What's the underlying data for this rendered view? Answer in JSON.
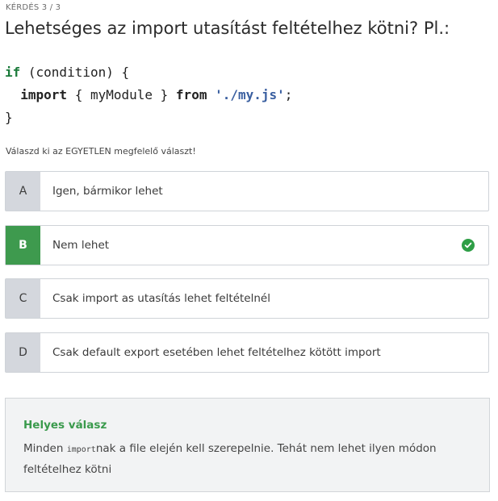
{
  "question": {
    "counter": "KÉRDÉS 3 / 3",
    "title": "Lehetséges az import utasítást feltételhez kötni? Pl.:",
    "code": {
      "line1": {
        "kw": "if",
        "rest": " (condition) {"
      },
      "line2": {
        "indent": "  ",
        "kw": "import",
        "mid": " { myModule } ",
        "kw2": "from",
        "space": " ",
        "str": "'./my.js'",
        "end": ";"
      },
      "line3": "}"
    },
    "instruction": "Válaszd ki az EGYETLEN megfelelő választ!"
  },
  "options": [
    {
      "letter": "A",
      "text": "Igen, bármikor lehet",
      "selected": false
    },
    {
      "letter": "B",
      "text": "Nem lehet",
      "selected": true,
      "icon": "check-circle-icon"
    },
    {
      "letter": "C",
      "text": "Csak import as utasítás lehet feltételnél",
      "selected": false
    },
    {
      "letter": "D",
      "text": "Csak default export esetében lehet feltételhez kötött import",
      "selected": false
    }
  ],
  "feedback": {
    "title": "Helyes válasz",
    "body_prefix": "Minden ",
    "body_code": "import",
    "body_suffix": "nak a file elején kell szerepelnie. Tehát nem lehet ilyen módon feltételhez kötni"
  },
  "colors": {
    "correct_green": "#3e9a4e",
    "letter_gray": "#d4d7dd",
    "feedback_bg": "#f2f3f4"
  }
}
